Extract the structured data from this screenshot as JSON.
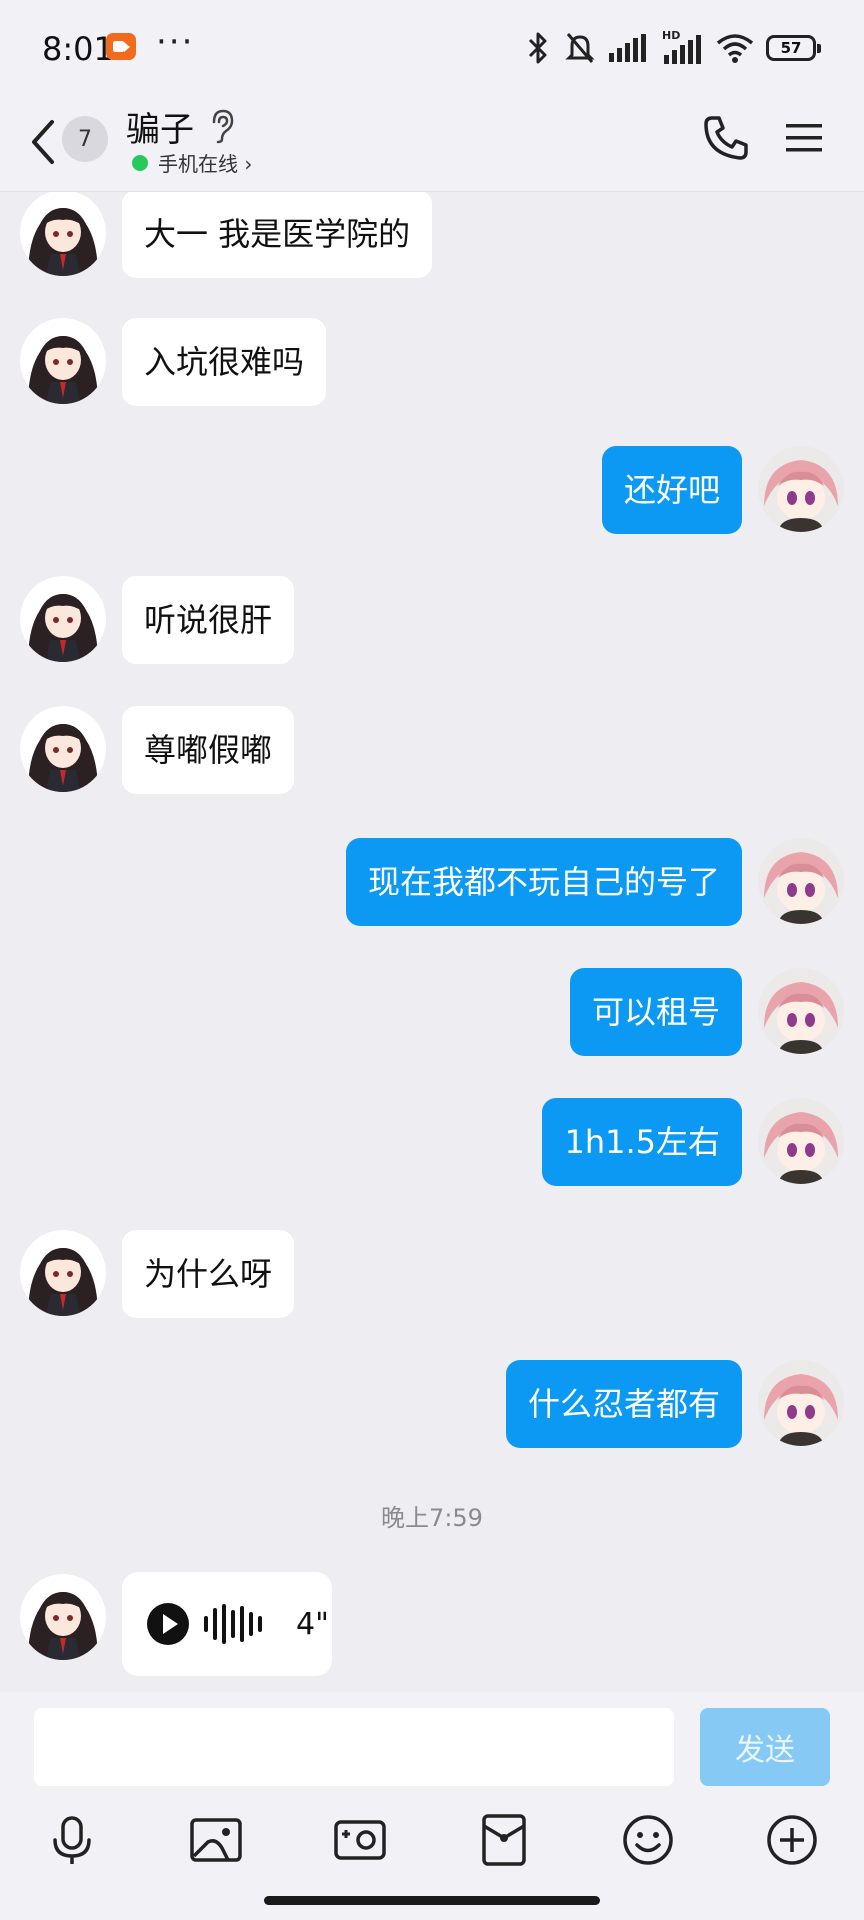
{
  "status_bar": {
    "time": "8:01",
    "dots": "···",
    "battery": "57",
    "network_label": "HD"
  },
  "header": {
    "unread_count": "7",
    "contact_name": "骗子",
    "online_status": "手机在线 ›"
  },
  "messages": [
    {
      "side": "left",
      "text": "大一 我是医学院的"
    },
    {
      "side": "left",
      "text": "入坑很难吗"
    },
    {
      "side": "right",
      "text": "还好吧"
    },
    {
      "side": "left",
      "text": "听说很肝"
    },
    {
      "side": "left",
      "text": "尊嘟假嘟"
    },
    {
      "side": "right",
      "text": "现在我都不玩自己的号了"
    },
    {
      "side": "right",
      "text": "可以租号"
    },
    {
      "side": "right",
      "text": "1h1.5左右"
    },
    {
      "side": "left",
      "text": "为什么呀"
    },
    {
      "side": "right",
      "text": "什么忍者都有"
    }
  ],
  "timestamp": "晚上7:59",
  "voice_message": {
    "side": "left",
    "duration": "4\""
  },
  "input": {
    "placeholder": "",
    "send_label": "发送"
  },
  "toolbar": {
    "items": [
      "microphone-icon",
      "image-icon",
      "camera-icon",
      "red-packet-icon",
      "emoji-icon",
      "plus-icon"
    ]
  },
  "colors": {
    "bubble_right": "#0c99f4",
    "bubble_left": "#ffffff",
    "background": "#ededf2",
    "online": "#27c95a"
  }
}
